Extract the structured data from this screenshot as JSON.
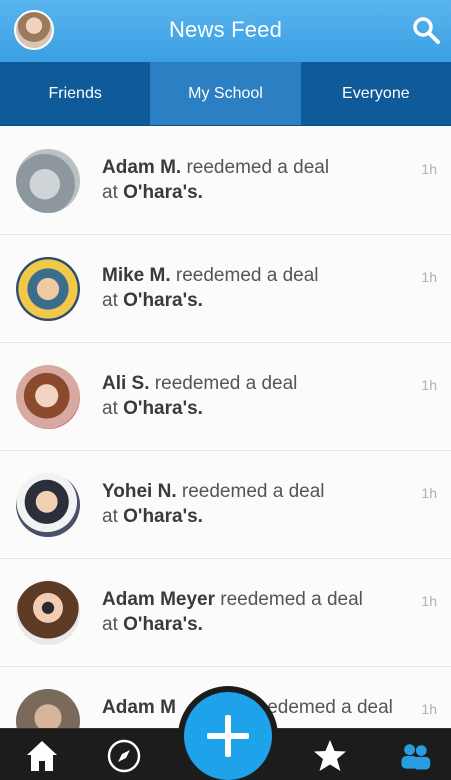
{
  "header": {
    "title": "News Feed"
  },
  "tabs": [
    {
      "label": "Friends",
      "active": false
    },
    {
      "label": "My School",
      "active": true
    },
    {
      "label": "Everyone",
      "active": false
    }
  ],
  "feed": [
    {
      "name": "Adam M.",
      "action": "reedemed a deal",
      "prefix": "at",
      "place": "O'hara's.",
      "time": "1h"
    },
    {
      "name": "Mike M.",
      "action": "reedemed a deal",
      "prefix": "at",
      "place": "O'hara's.",
      "time": "1h"
    },
    {
      "name": "Ali S.",
      "action": "reedemed a deal",
      "prefix": "at",
      "place": "O'hara's.",
      "time": "1h"
    },
    {
      "name": "Yohei N.",
      "action": "reedemed a deal",
      "prefix": "at",
      "place": "O'hara's.",
      "time": "1h"
    },
    {
      "name": "Adam Meyer",
      "action": "reedemed a deal",
      "prefix": "at",
      "place": "O'hara's.",
      "time": "1h"
    },
    {
      "name": "Adam M",
      "action": "edemed a deal",
      "prefix": "",
      "place": "",
      "time": "1h"
    }
  ],
  "nav": {
    "items": [
      "home-icon",
      "compass-icon",
      "add-icon",
      "star-icon",
      "friends-icon"
    ]
  },
  "colors": {
    "header": "#3aa0e2",
    "tab_bar": "#0f5a99",
    "active_tab": "#2c7fc3",
    "nav_bar": "#1c1c1c",
    "fab": "#1ea2ea",
    "friends_icon": "#2a9de0"
  }
}
